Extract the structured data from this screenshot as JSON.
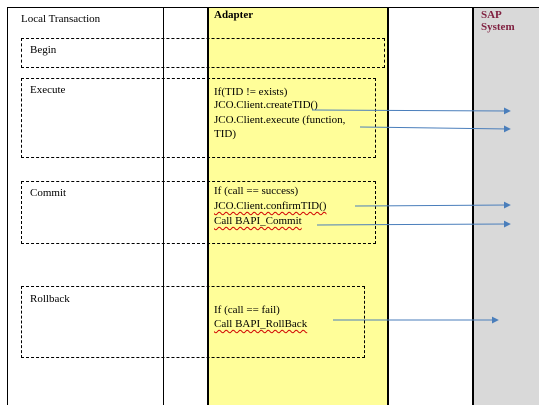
{
  "diagram": {
    "lanes": {
      "local_transaction": "Local Transaction",
      "adapter": "Adapter",
      "sap_system": "SAP\nSystem"
    },
    "phases": {
      "begin": "Begin",
      "execute": "Execute",
      "commit": "Commit",
      "rollback": "Rollback"
    },
    "execute_code": [
      " If(TID != exists)",
      "JCO.Client.createTID()",
      "JCO.Client.execute (function,",
      "TID)"
    ],
    "commit_code": [
      "If (call == success)",
      "JCO.Client.confirmTID()",
      "Call BAPI_Commit"
    ],
    "rollback_code": [
      "If (call == fail)",
      "Call BAPI_RollBack"
    ],
    "colors": {
      "adapter_fill": "#fffe99",
      "sap_fill": "#d9d9d9",
      "arrow": "#4a7ebb",
      "sap_title": "#7f1f3f"
    }
  }
}
